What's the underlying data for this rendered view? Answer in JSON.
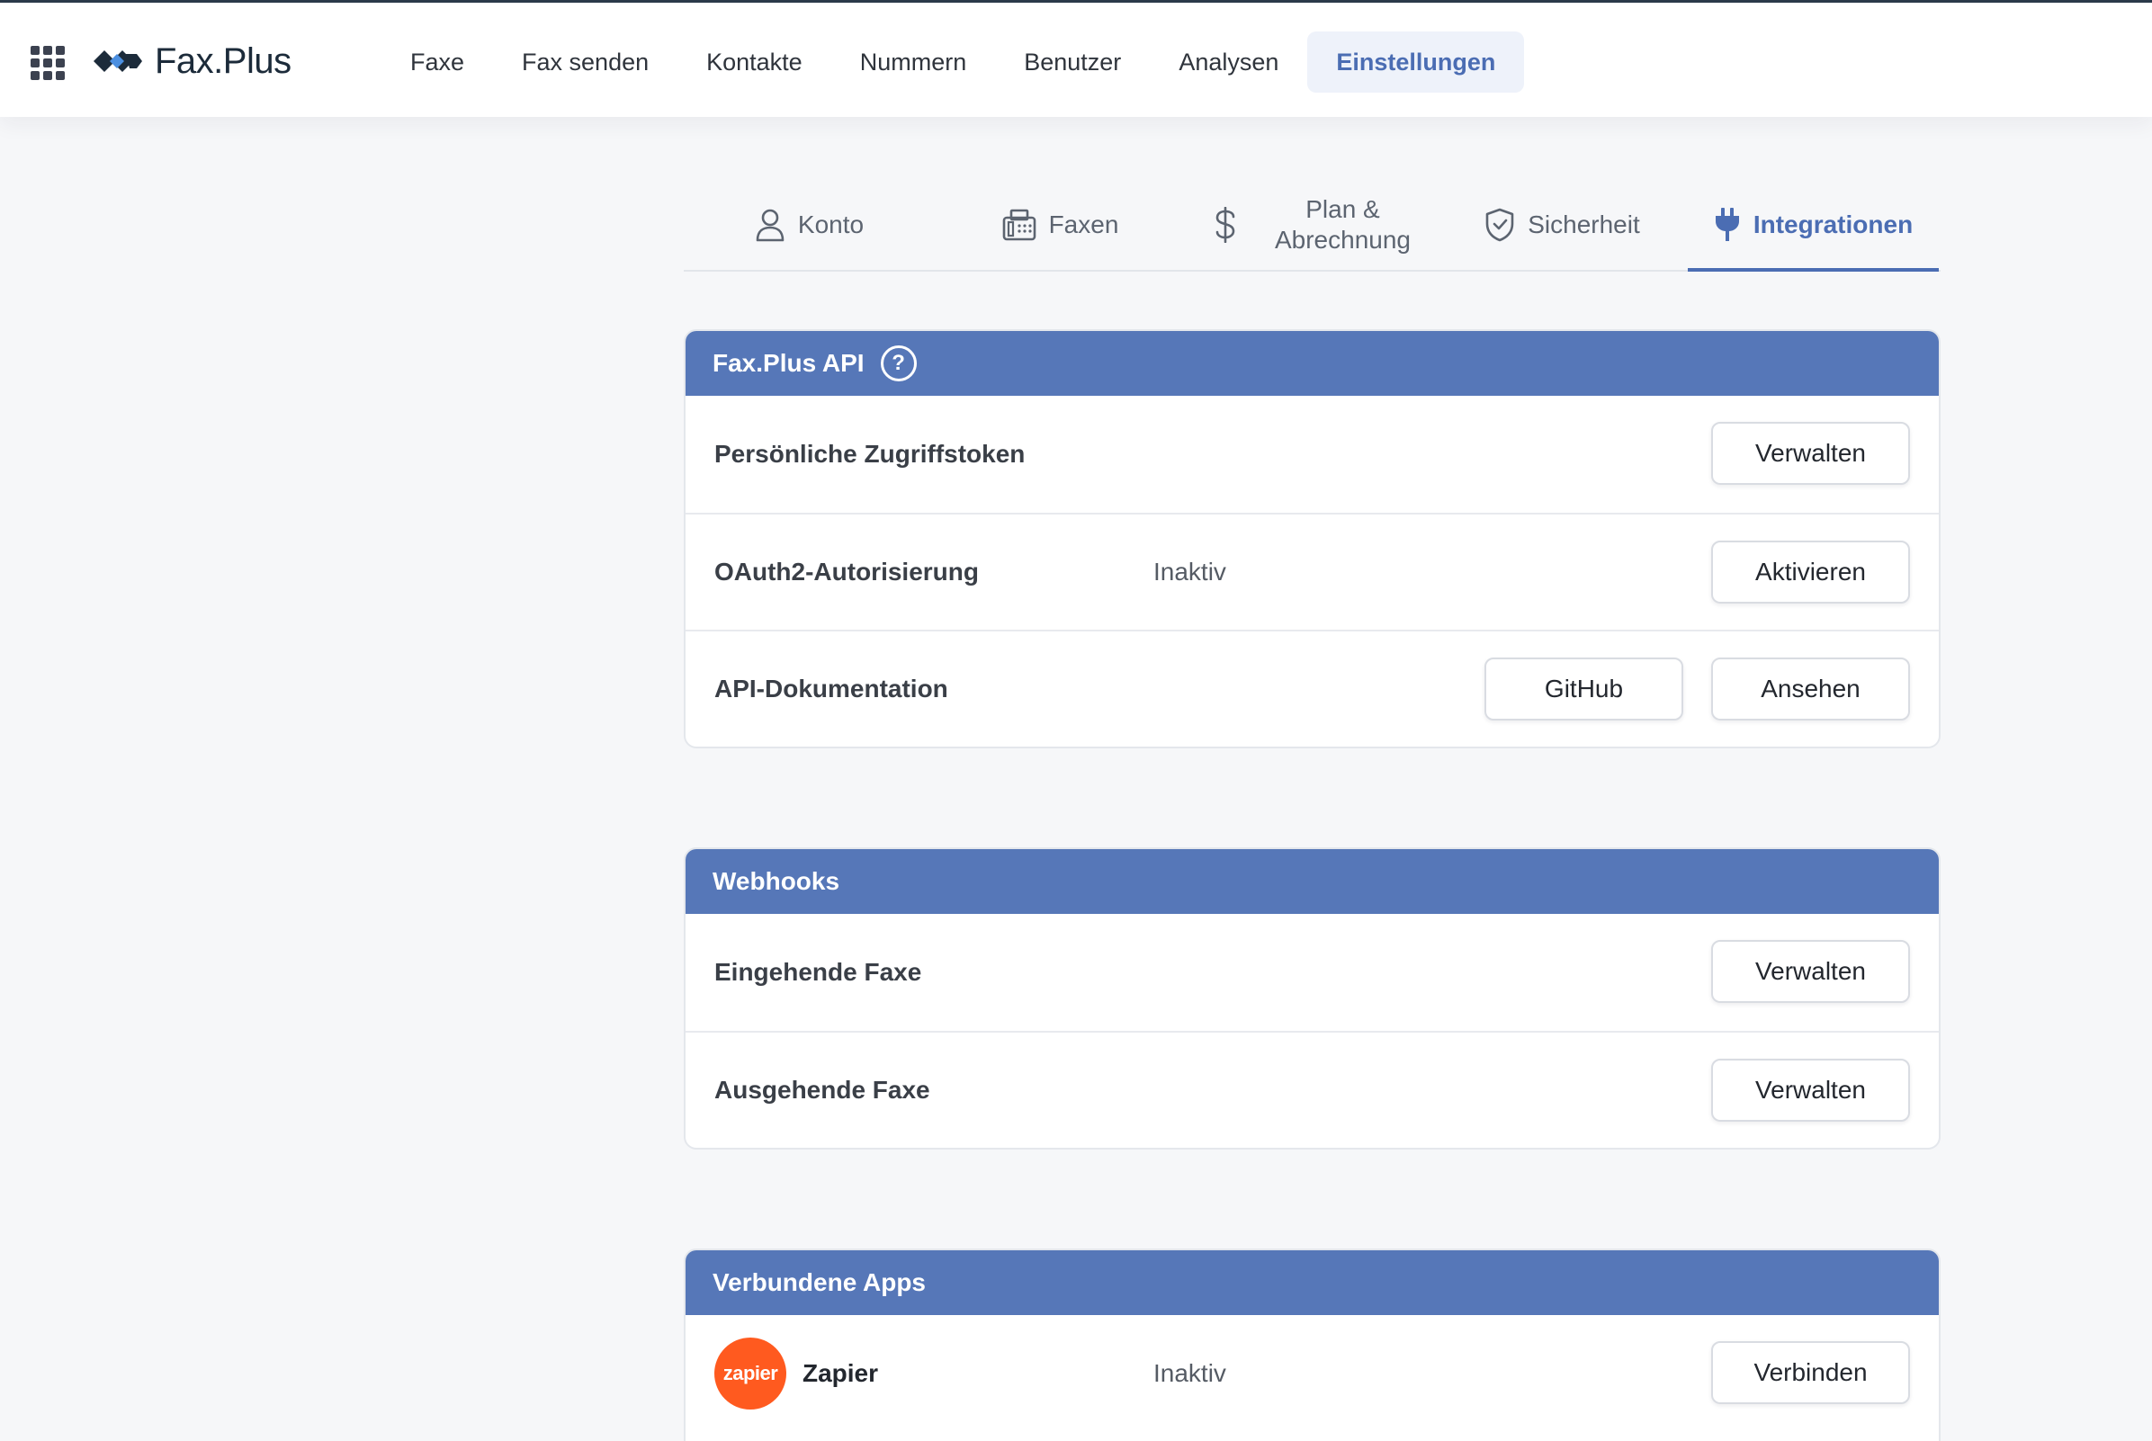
{
  "app": {
    "brand": "Fax.Plus"
  },
  "topnav": [
    {
      "label": "Faxe"
    },
    {
      "label": "Fax senden"
    },
    {
      "label": "Kontakte"
    },
    {
      "label": "Nummern"
    },
    {
      "label": "Benutzer"
    },
    {
      "label": "Analysen"
    },
    {
      "label": "Einstellungen",
      "active": true
    }
  ],
  "tabs": [
    {
      "label": "Konto",
      "icon": "user-icon"
    },
    {
      "label": "Faxen",
      "icon": "fax-icon"
    },
    {
      "label_line1": "Plan &",
      "label_line2": "Abrechnung",
      "icon": "dollar-icon"
    },
    {
      "label": "Sicherheit",
      "icon": "shield-icon"
    },
    {
      "label": "Integrationen",
      "icon": "plug-icon",
      "active": true
    }
  ],
  "api_card": {
    "title": "Fax.Plus API",
    "help_glyph": "?",
    "rows": [
      {
        "label": "Persönliche Zugriffstoken",
        "status": "",
        "button": "Verwalten"
      },
      {
        "label": "OAuth2-Autorisierung",
        "status": "Inaktiv",
        "button": "Aktivieren"
      },
      {
        "label": "API-Dokumentation",
        "status": "",
        "secondary_button": "GitHub",
        "button": "Ansehen"
      }
    ]
  },
  "webhooks_card": {
    "title": "Webhooks",
    "rows": [
      {
        "label": "Eingehende Faxe",
        "button": "Verwalten"
      },
      {
        "label": "Ausgehende Faxe",
        "button": "Verwalten"
      }
    ]
  },
  "apps_card": {
    "title": "Verbundene Apps",
    "rows": [
      {
        "logo_text": "zapier",
        "label": "Zapier",
        "status": "Inaktiv",
        "button": "Verbinden"
      }
    ]
  },
  "colors": {
    "accent": "#4b6db3",
    "card_header": "#5677b8",
    "zapier": "#ff5a1f",
    "page_bg": "#f6f7f9"
  }
}
